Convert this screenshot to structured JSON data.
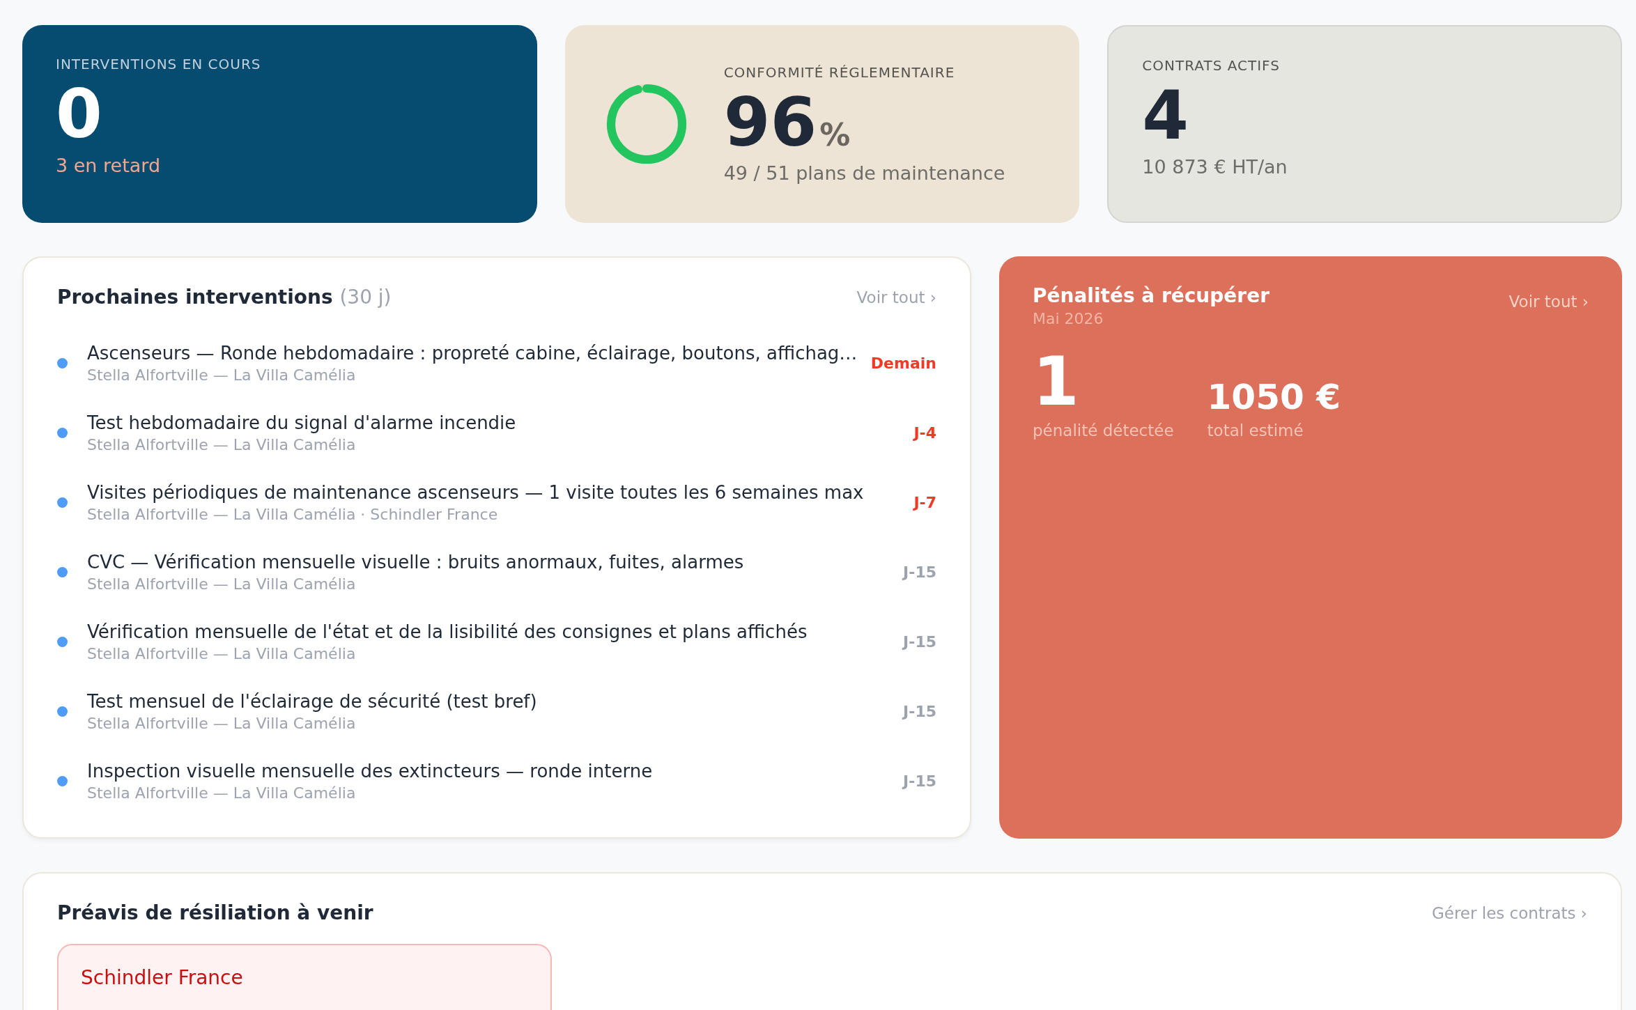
{
  "kpis": {
    "interventions": {
      "label": "INTERVENTIONS EN COURS",
      "value": "0",
      "note": "3 en retard"
    },
    "compliance": {
      "label": "CONFORMITÉ RÉGLEMENTAIRE",
      "value": "96",
      "unit": "%",
      "level": 0.96,
      "note": "49 / 51 plans de maintenance"
    },
    "contracts": {
      "label": "CONTRATS ACTIFS",
      "value": "4",
      "note": "10 873 € HT/an"
    }
  },
  "upcoming": {
    "title": "Prochaines interventions",
    "period": "(30 j)",
    "link": "Voir tout",
    "link_icon": "›",
    "items": [
      {
        "title": "Ascenseurs — Ronde hebdomadaire : propreté cabine, éclairage, boutons, affichag…",
        "site": "Stella Alfortville — La Villa Camélia",
        "due": "Demain",
        "urgent": true
      },
      {
        "title": "Test hebdomadaire du signal d'alarme incendie",
        "site": "Stella Alfortville — La Villa Camélia",
        "due": "J-4",
        "urgent": true
      },
      {
        "title": "Visites périodiques de maintenance ascenseurs — 1 visite toutes les 6 semaines max",
        "site": "Stella Alfortville — La Villa Camélia · Schindler France",
        "due": "J-7",
        "urgent": true
      },
      {
        "title": "CVC — Vérification mensuelle visuelle : bruits anormaux, fuites, alarmes",
        "site": "Stella Alfortville — La Villa Camélia",
        "due": "J-15",
        "urgent": false
      },
      {
        "title": "Vérification mensuelle de l'état et de la lisibilité des consignes et plans affichés",
        "site": "Stella Alfortville — La Villa Camélia",
        "due": "J-15",
        "urgent": false
      },
      {
        "title": "Test mensuel de l'éclairage de sécurité (test bref)",
        "site": "Stella Alfortville — La Villa Camélia",
        "due": "J-15",
        "urgent": false
      },
      {
        "title": "Inspection visuelle mensuelle des extincteurs — ronde interne",
        "site": "Stella Alfortville — La Villa Camélia",
        "due": "J-15",
        "urgent": false
      }
    ]
  },
  "penalties": {
    "title": "Pénalités à récupérer",
    "period": "Mai 2026",
    "link": "Voir tout",
    "link_icon": "›",
    "stats": [
      {
        "value": "1",
        "label": "pénalité détectée",
        "kind": "count"
      },
      {
        "value": "1050 €",
        "label": "total estimé",
        "kind": "amount"
      }
    ]
  },
  "notices": {
    "title": "Préavis de résiliation à venir",
    "link": "Gérer les contrats",
    "link_icon": "›",
    "cards": [
      {
        "name": "Schindler France"
      }
    ]
  }
}
